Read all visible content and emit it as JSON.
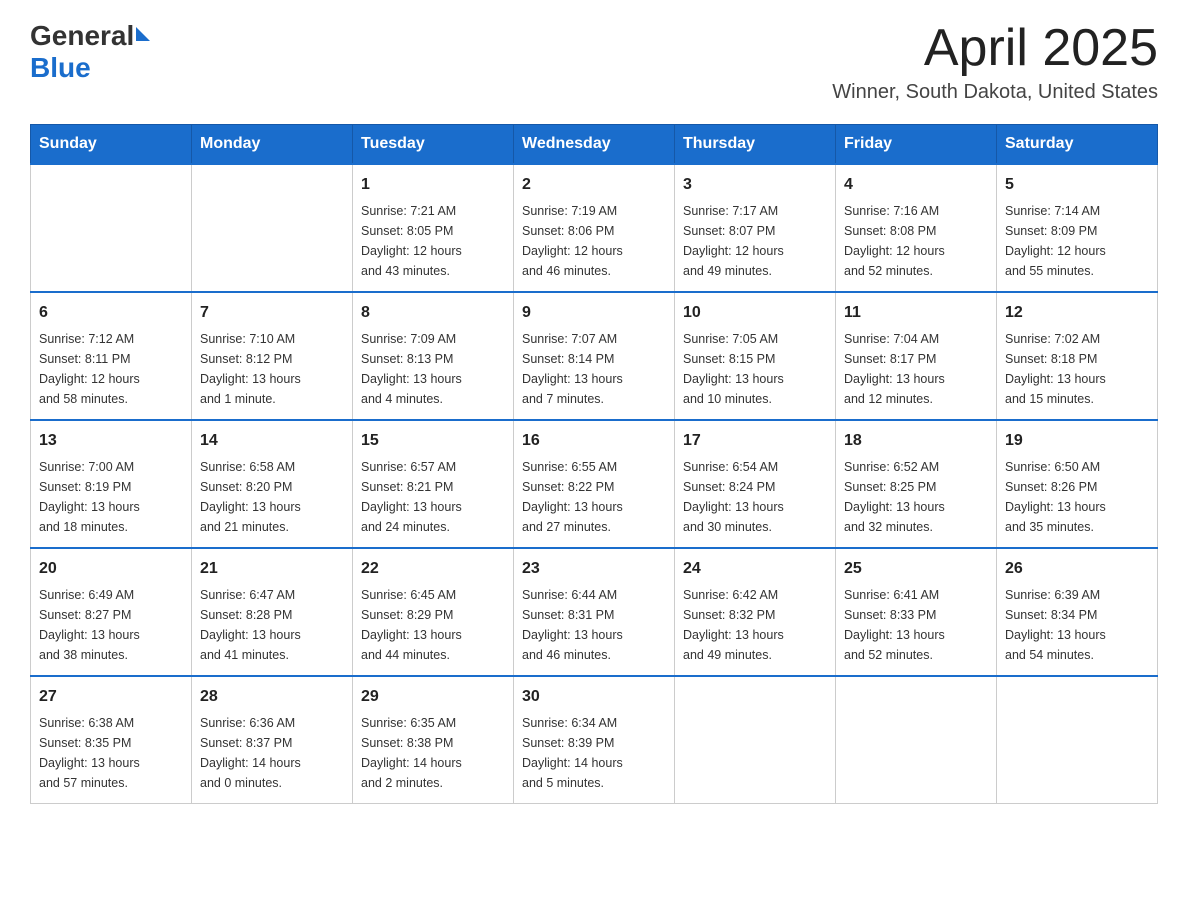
{
  "header": {
    "logo_general": "General",
    "logo_blue": "Blue",
    "month": "April 2025",
    "location": "Winner, South Dakota, United States"
  },
  "days_of_week": [
    "Sunday",
    "Monday",
    "Tuesday",
    "Wednesday",
    "Thursday",
    "Friday",
    "Saturday"
  ],
  "weeks": [
    [
      {
        "day": "",
        "info": ""
      },
      {
        "day": "",
        "info": ""
      },
      {
        "day": "1",
        "info": "Sunrise: 7:21 AM\nSunset: 8:05 PM\nDaylight: 12 hours\nand 43 minutes."
      },
      {
        "day": "2",
        "info": "Sunrise: 7:19 AM\nSunset: 8:06 PM\nDaylight: 12 hours\nand 46 minutes."
      },
      {
        "day": "3",
        "info": "Sunrise: 7:17 AM\nSunset: 8:07 PM\nDaylight: 12 hours\nand 49 minutes."
      },
      {
        "day": "4",
        "info": "Sunrise: 7:16 AM\nSunset: 8:08 PM\nDaylight: 12 hours\nand 52 minutes."
      },
      {
        "day": "5",
        "info": "Sunrise: 7:14 AM\nSunset: 8:09 PM\nDaylight: 12 hours\nand 55 minutes."
      }
    ],
    [
      {
        "day": "6",
        "info": "Sunrise: 7:12 AM\nSunset: 8:11 PM\nDaylight: 12 hours\nand 58 minutes."
      },
      {
        "day": "7",
        "info": "Sunrise: 7:10 AM\nSunset: 8:12 PM\nDaylight: 13 hours\nand 1 minute."
      },
      {
        "day": "8",
        "info": "Sunrise: 7:09 AM\nSunset: 8:13 PM\nDaylight: 13 hours\nand 4 minutes."
      },
      {
        "day": "9",
        "info": "Sunrise: 7:07 AM\nSunset: 8:14 PM\nDaylight: 13 hours\nand 7 minutes."
      },
      {
        "day": "10",
        "info": "Sunrise: 7:05 AM\nSunset: 8:15 PM\nDaylight: 13 hours\nand 10 minutes."
      },
      {
        "day": "11",
        "info": "Sunrise: 7:04 AM\nSunset: 8:17 PM\nDaylight: 13 hours\nand 12 minutes."
      },
      {
        "day": "12",
        "info": "Sunrise: 7:02 AM\nSunset: 8:18 PM\nDaylight: 13 hours\nand 15 minutes."
      }
    ],
    [
      {
        "day": "13",
        "info": "Sunrise: 7:00 AM\nSunset: 8:19 PM\nDaylight: 13 hours\nand 18 minutes."
      },
      {
        "day": "14",
        "info": "Sunrise: 6:58 AM\nSunset: 8:20 PM\nDaylight: 13 hours\nand 21 minutes."
      },
      {
        "day": "15",
        "info": "Sunrise: 6:57 AM\nSunset: 8:21 PM\nDaylight: 13 hours\nand 24 minutes."
      },
      {
        "day": "16",
        "info": "Sunrise: 6:55 AM\nSunset: 8:22 PM\nDaylight: 13 hours\nand 27 minutes."
      },
      {
        "day": "17",
        "info": "Sunrise: 6:54 AM\nSunset: 8:24 PM\nDaylight: 13 hours\nand 30 minutes."
      },
      {
        "day": "18",
        "info": "Sunrise: 6:52 AM\nSunset: 8:25 PM\nDaylight: 13 hours\nand 32 minutes."
      },
      {
        "day": "19",
        "info": "Sunrise: 6:50 AM\nSunset: 8:26 PM\nDaylight: 13 hours\nand 35 minutes."
      }
    ],
    [
      {
        "day": "20",
        "info": "Sunrise: 6:49 AM\nSunset: 8:27 PM\nDaylight: 13 hours\nand 38 minutes."
      },
      {
        "day": "21",
        "info": "Sunrise: 6:47 AM\nSunset: 8:28 PM\nDaylight: 13 hours\nand 41 minutes."
      },
      {
        "day": "22",
        "info": "Sunrise: 6:45 AM\nSunset: 8:29 PM\nDaylight: 13 hours\nand 44 minutes."
      },
      {
        "day": "23",
        "info": "Sunrise: 6:44 AM\nSunset: 8:31 PM\nDaylight: 13 hours\nand 46 minutes."
      },
      {
        "day": "24",
        "info": "Sunrise: 6:42 AM\nSunset: 8:32 PM\nDaylight: 13 hours\nand 49 minutes."
      },
      {
        "day": "25",
        "info": "Sunrise: 6:41 AM\nSunset: 8:33 PM\nDaylight: 13 hours\nand 52 minutes."
      },
      {
        "day": "26",
        "info": "Sunrise: 6:39 AM\nSunset: 8:34 PM\nDaylight: 13 hours\nand 54 minutes."
      }
    ],
    [
      {
        "day": "27",
        "info": "Sunrise: 6:38 AM\nSunset: 8:35 PM\nDaylight: 13 hours\nand 57 minutes."
      },
      {
        "day": "28",
        "info": "Sunrise: 6:36 AM\nSunset: 8:37 PM\nDaylight: 14 hours\nand 0 minutes."
      },
      {
        "day": "29",
        "info": "Sunrise: 6:35 AM\nSunset: 8:38 PM\nDaylight: 14 hours\nand 2 minutes."
      },
      {
        "day": "30",
        "info": "Sunrise: 6:34 AM\nSunset: 8:39 PM\nDaylight: 14 hours\nand 5 minutes."
      },
      {
        "day": "",
        "info": ""
      },
      {
        "day": "",
        "info": ""
      },
      {
        "day": "",
        "info": ""
      }
    ]
  ]
}
